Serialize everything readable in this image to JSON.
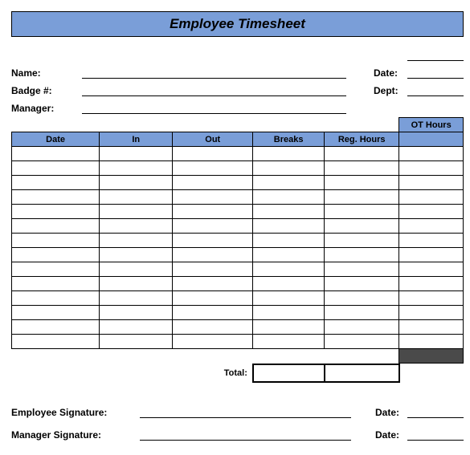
{
  "title": "Employee Timesheet",
  "fields": {
    "name_label": "Name:",
    "badge_label": "Badge #:",
    "manager_label": "Manager:",
    "date_label": "Date:",
    "dept_label": "Dept:",
    "name_value": "",
    "badge_value": "",
    "manager_value": "",
    "date_value": "",
    "dept_value": ""
  },
  "table": {
    "headers": {
      "date": "Date",
      "in": "In",
      "out": "Out",
      "breaks": "Breaks",
      "reg_hours": "Reg. Hours",
      "ot_hours": "OT Hours"
    },
    "rows": [
      {
        "date": "",
        "in": "",
        "out": "",
        "breaks": "",
        "reg": "",
        "ot": ""
      },
      {
        "date": "",
        "in": "",
        "out": "",
        "breaks": "",
        "reg": "",
        "ot": ""
      },
      {
        "date": "",
        "in": "",
        "out": "",
        "breaks": "",
        "reg": "",
        "ot": ""
      },
      {
        "date": "",
        "in": "",
        "out": "",
        "breaks": "",
        "reg": "",
        "ot": ""
      },
      {
        "date": "",
        "in": "",
        "out": "",
        "breaks": "",
        "reg": "",
        "ot": ""
      },
      {
        "date": "",
        "in": "",
        "out": "",
        "breaks": "",
        "reg": "",
        "ot": ""
      },
      {
        "date": "",
        "in": "",
        "out": "",
        "breaks": "",
        "reg": "",
        "ot": ""
      },
      {
        "date": "",
        "in": "",
        "out": "",
        "breaks": "",
        "reg": "",
        "ot": ""
      },
      {
        "date": "",
        "in": "",
        "out": "",
        "breaks": "",
        "reg": "",
        "ot": ""
      },
      {
        "date": "",
        "in": "",
        "out": "",
        "breaks": "",
        "reg": "",
        "ot": ""
      },
      {
        "date": "",
        "in": "",
        "out": "",
        "breaks": "",
        "reg": "",
        "ot": ""
      },
      {
        "date": "",
        "in": "",
        "out": "",
        "breaks": "",
        "reg": "",
        "ot": ""
      },
      {
        "date": "",
        "in": "",
        "out": "",
        "breaks": "",
        "reg": "",
        "ot": ""
      },
      {
        "date": "",
        "in": "",
        "out": "",
        "breaks": "",
        "reg": "",
        "ot": ""
      }
    ],
    "total_label": "Total:",
    "total_breaks": "",
    "total_reg": "",
    "total_ot": ""
  },
  "signatures": {
    "employee_label": "Employee Signature:",
    "manager_label": "Manager Signature:",
    "date_label": "Date:",
    "employee_value": "",
    "manager_value": "",
    "employee_date": "",
    "manager_date": ""
  }
}
